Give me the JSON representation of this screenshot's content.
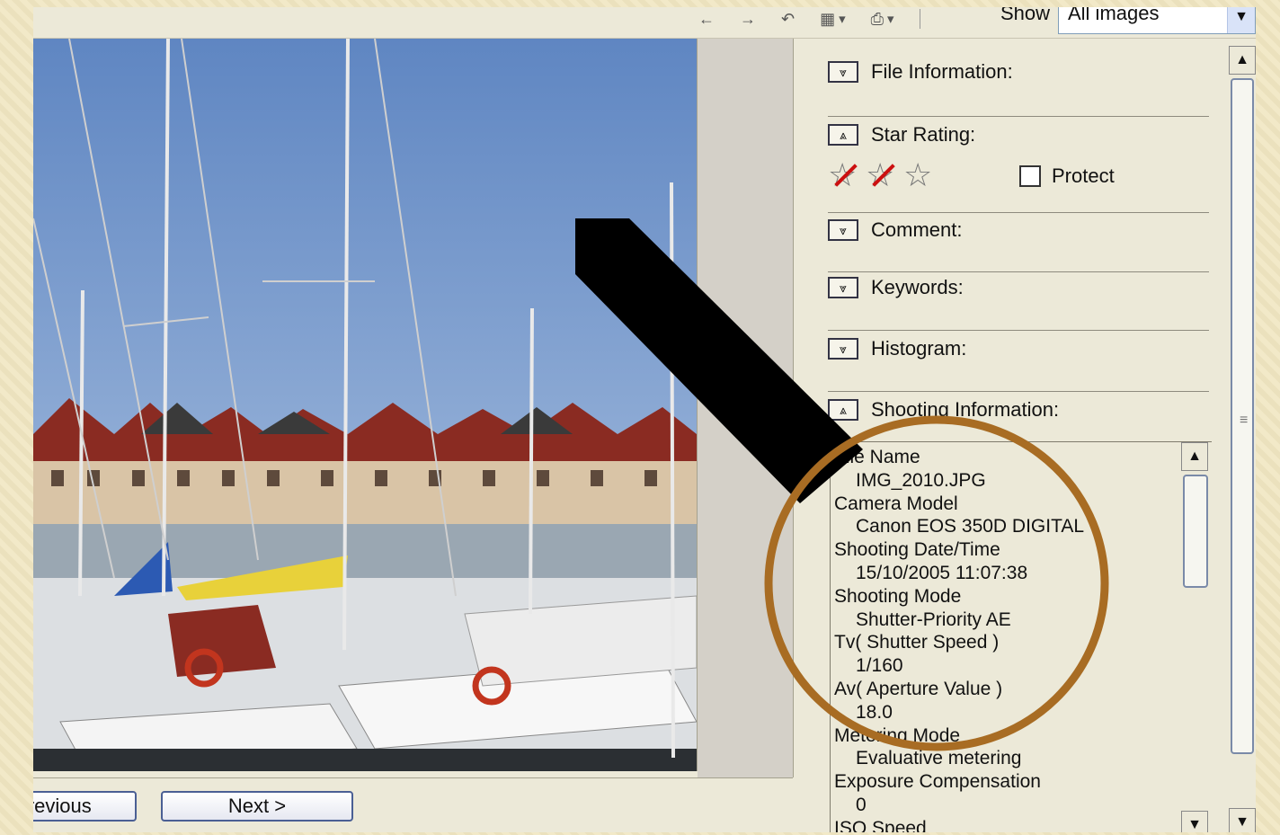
{
  "toolbar": {
    "show_label": "Show",
    "show_value": "All images",
    "icons": [
      "back-arrow-icon",
      "forward-arrow-icon",
      "rotate-icon",
      "select-tool-icon",
      "print-icon"
    ]
  },
  "nav": {
    "previous_label": "< Previous",
    "next_label": "Next >"
  },
  "panel": {
    "sections": {
      "file_information": "File Information:",
      "star_rating": "Star Rating:",
      "comment": "Comment:",
      "keywords": "Keywords:",
      "histogram": "Histogram:",
      "shooting_information": "Shooting Information:"
    },
    "stars": [
      "☆",
      "☆",
      "☆"
    ],
    "protect_label": "Protect",
    "shooting_info": [
      {
        "label": "File Name",
        "value": "IMG_2010.JPG"
      },
      {
        "label": "Camera Model",
        "value": "Canon EOS 350D DIGITAL"
      },
      {
        "label": "Shooting Date/Time",
        "value": "15/10/2005 11:07:38"
      },
      {
        "label": "Shooting Mode",
        "value": "Shutter-Priority AE"
      },
      {
        "label": "Tv( Shutter Speed )",
        "value": "1/160"
      },
      {
        "label": "Av( Aperture Value )",
        "value": "18.0"
      },
      {
        "label": "Metering Mode",
        "value": "Evaluative metering"
      },
      {
        "label": "Exposure Compensation",
        "value": "0"
      },
      {
        "label": "ISO Speed",
        "value": ""
      }
    ]
  },
  "colors": {
    "annotation_circle": "#a86c23",
    "annotation_bar": "#000000",
    "sky": "#7fa2d2"
  }
}
